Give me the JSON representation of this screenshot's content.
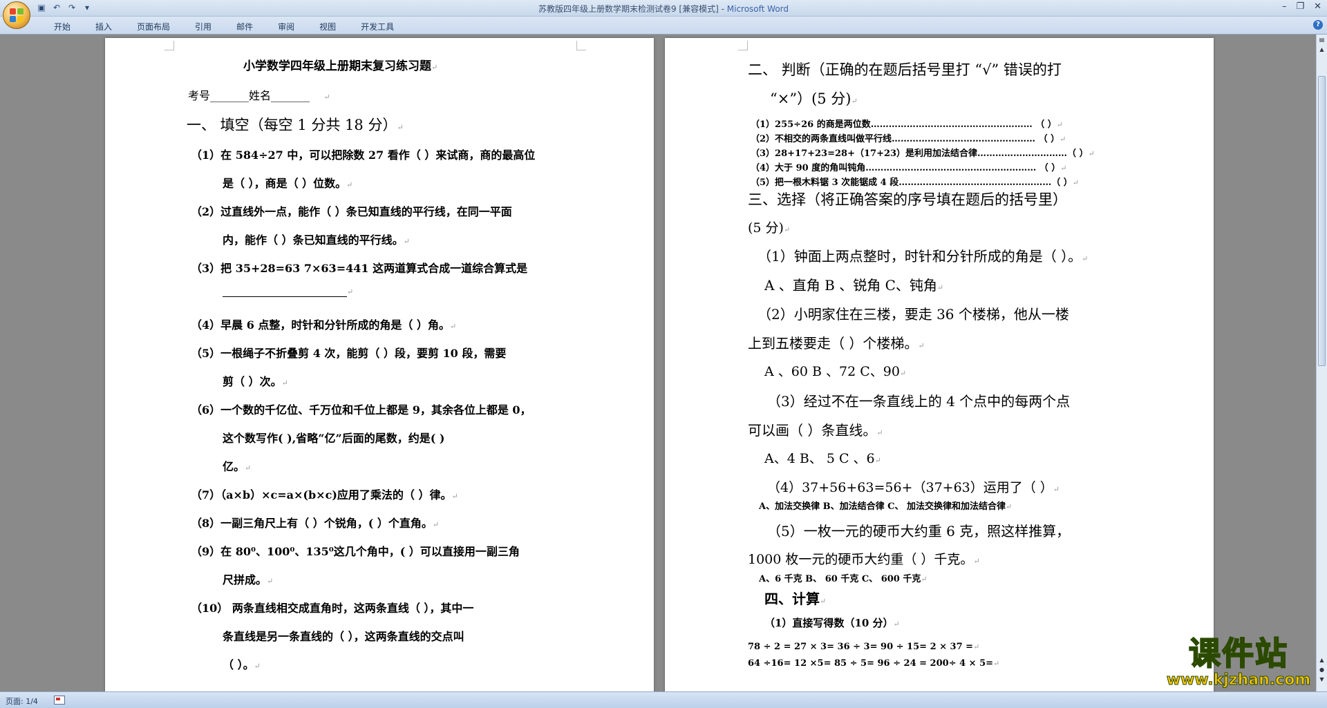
{
  "window": {
    "title": "苏教版四年级上册数学期末检测试卷9 [兼容模式] - ",
    "app_name": "Microsoft Word"
  },
  "ribbon": {
    "tabs": [
      "开始",
      "插入",
      "页面布局",
      "引用",
      "邮件",
      "审阅",
      "视图",
      "开发工具"
    ]
  },
  "status": {
    "page": "页面: 1/4"
  },
  "watermark": {
    "main": "课件站",
    "url": "www.kjzhan.com"
  },
  "left_page": {
    "title": "小学数学四年级上册期末复习练习题",
    "student_line": "考号_______姓名_______",
    "section1": "一、 填空（每空 1 分共 18 分）",
    "q1a": "（1）在 584÷27 中，可以把除数 27 看作（    ）来试商，商的最高位",
    "q1b": "是（  ），商是（  ）位数。",
    "q2a": "（2）过直线外一点，能作（  ）条已知直线的平行线，在同一平面",
    "q2b": "内，能作（    ）条已知直线的平行线。",
    "q3a": "（3）把  35+28=63     7×63=441  这两道算式合成一道综合算式是",
    "q4": "（4）早晨 6 点整，时针和分针所成的角是（    ）角。",
    "q5a": "（5）一根绳子不折叠剪 4 次，能剪（      ）段，要剪 10 段，需要",
    "q5b": "剪（      ）次。",
    "q6a": "（6）一个数的千亿位、千万位和千位上都是 9，其余各位上都是 0，",
    "q6b": "这个数写作(          ),省略“亿”后面的尾数，约是(                )",
    "q6c": "亿。",
    "q7": "（7）（a×b）×c=a×(b×c)应用了乘法的（          ）律。",
    "q8": "（8）一副三角尺上有（    ）个锐角，(        ）个直角。",
    "q9a": "（9）在 80⁰、100⁰、135⁰这几个角中，(        ）可以直接用一副三角",
    "q9b": "尺拼成。",
    "q10a": "（10）      两条直线相交成直角时，这两条直线（              ），其中一",
    "q10b": "条直线是另一条直线的（              ），这两条直线的交点叫",
    "q10c": "（          ）。"
  },
  "right_page": {
    "section2a": "二、 判断（正确的在题后括号里打 “√” 错误的打",
    "section2b": "“×”）(5 分)",
    "j1": "（1）255÷26 的商是两位数………………………………………………  （    ）",
    "j2": "（2）不相交的两条直线叫做平行线…………………………………………  （    ）",
    "j3": "（3）28+17+23=28+（17+23）是利用加法结合律…………………………（    ）",
    "j4": "（4）大于 90 度的角叫钝角…………………………………………………  （    ）",
    "j5": "（5）把一根木料锯 3 次能锯成 4 段……………………………………………（    ）",
    "section3a": "三、选择（将正确答案的序号填在题后的括号里）",
    "section3b": "(5 分)",
    "c1": "（1）钟面上两点整时，时针和分针所成的角是（    ）。",
    "c1_opts": "A 、直角              B 、锐角              C、钝角",
    "c2a": "（2）小明家住在三楼，要走  36  个楼梯，他从一楼",
    "c2b": "上到五楼要走（      ）个楼梯。",
    "c2_opts": "A 、60                  B 、72                C、90",
    "c3a": "（3）经过不在一条直线上的  4  个点中的每两个点",
    "c3b": "可以画（   ）条直线。",
    "c3_opts": "A、4                     B、  5                  C  、6",
    "c4": "（4）37+56+63=56+（37+63）运用了（        ）",
    "c4_opts": "A、加法交换律    B、加法结合律    C、  加法交换律和加法结合律",
    "c5a": "（5）一枚一元的硬币大约重  6  克，照这样推算，",
    "c5b": "1000 枚一元的硬币大约重（        ）千克。",
    "c5_opts": "A、6 千克                B、  60 千克                C、   600 千克",
    "section4": "四、计算",
    "calc1": "（1）直接写得数（10 分）",
    "calc_row1": "78  ÷ 2 =          27  ×  3=          36  ÷    3=          90    ÷  15=          2  ×  37  =",
    "calc_row2": "64  ÷16=          12  ×5=          85  ÷ 5=          96    ÷  24 =          200÷   4  ×  5="
  }
}
